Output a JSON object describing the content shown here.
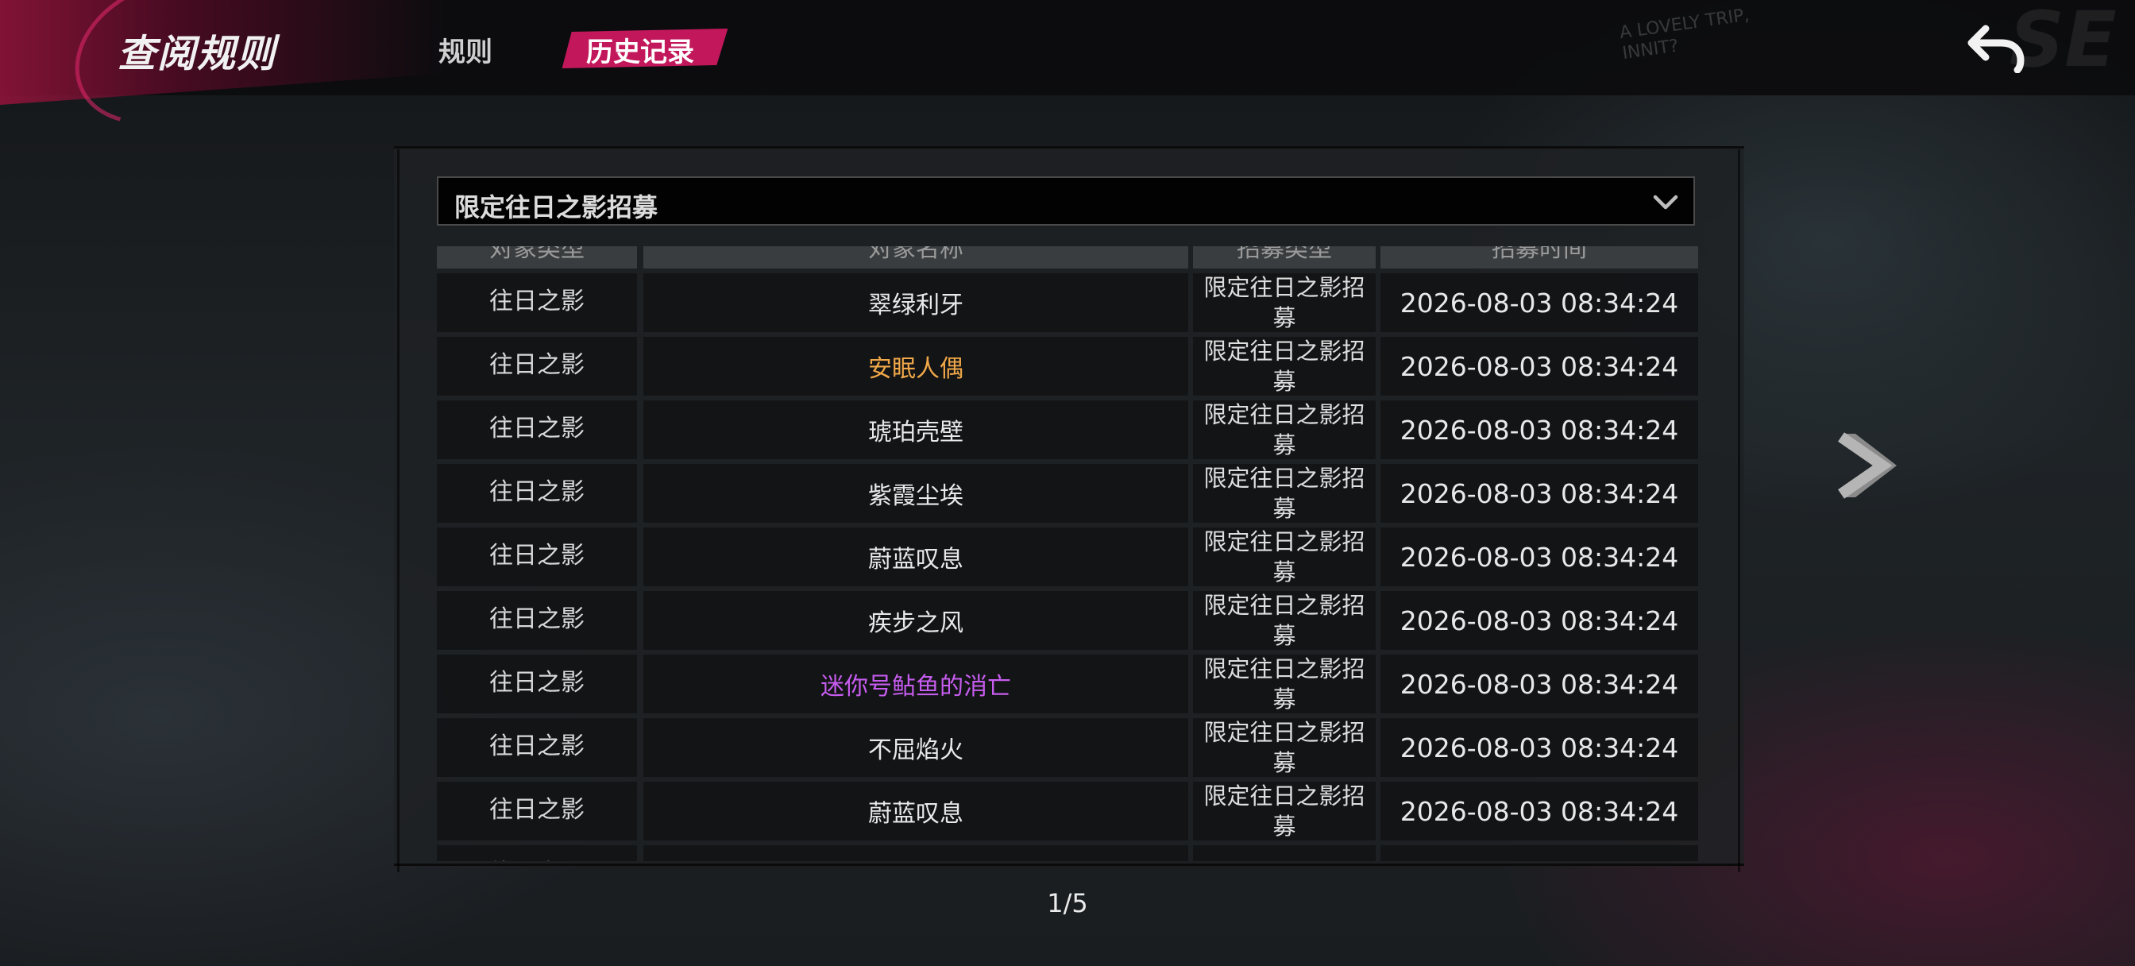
{
  "header": {
    "title": "查阅规则",
    "tabs": [
      {
        "label": "规则",
        "active": false
      },
      {
        "label": "历史记录",
        "active": true
      }
    ],
    "deco_text": "A LOVELY TRIP, INNIT?",
    "deco_big": "SE",
    "back_icon": "back-arrow-icon"
  },
  "colors": {
    "accent": "#c2185b",
    "rarity_gold": "#f0a848",
    "rarity_purple": "#c75df0",
    "rarity_normal": "#e9e9e9"
  },
  "filter": {
    "selected": "限定往日之影招募",
    "icon": "chevron-down-icon"
  },
  "table": {
    "columns": [
      "对象类型",
      "对象名称",
      "招募类型",
      "招募时间"
    ],
    "rows": [
      {
        "type": "往日之影",
        "name": "翠绿利牙",
        "name_color": "#e9e9e9",
        "recruit_type": "限定往日之影招募",
        "time": "2026-08-03 08:34:24"
      },
      {
        "type": "往日之影",
        "name": "安眠人偶",
        "name_color": "#f0a848",
        "recruit_type": "限定往日之影招募",
        "time": "2026-08-03 08:34:24"
      },
      {
        "type": "往日之影",
        "name": "琥珀壳壁",
        "name_color": "#e9e9e9",
        "recruit_type": "限定往日之影招募",
        "time": "2026-08-03 08:34:24"
      },
      {
        "type": "往日之影",
        "name": "紫霞尘埃",
        "name_color": "#e9e9e9",
        "recruit_type": "限定往日之影招募",
        "time": "2026-08-03 08:34:24"
      },
      {
        "type": "往日之影",
        "name": "蔚蓝叹息",
        "name_color": "#e9e9e9",
        "recruit_type": "限定往日之影招募",
        "time": "2026-08-03 08:34:24"
      },
      {
        "type": "往日之影",
        "name": "疾步之风",
        "name_color": "#e9e9e9",
        "recruit_type": "限定往日之影招募",
        "time": "2026-08-03 08:34:24"
      },
      {
        "type": "往日之影",
        "name": "迷你号鲇鱼的消亡",
        "name_color": "#c75df0",
        "recruit_type": "限定往日之影招募",
        "time": "2026-08-03 08:34:24"
      },
      {
        "type": "往日之影",
        "name": "不屈焰火",
        "name_color": "#e9e9e9",
        "recruit_type": "限定往日之影招募",
        "time": "2026-08-03 08:34:24"
      },
      {
        "type": "往日之影",
        "name": "蔚蓝叹息",
        "name_color": "#e9e9e9",
        "recruit_type": "限定往日之影招募",
        "time": "2026-08-03 08:34:24"
      },
      {
        "type": "往日之影",
        "name": "",
        "name_color": "#e9e9e9",
        "recruit_type": "限定往日之影",
        "time": ""
      }
    ]
  },
  "pagination": {
    "label": "1/5",
    "next_icon": "chevron-right-icon"
  }
}
